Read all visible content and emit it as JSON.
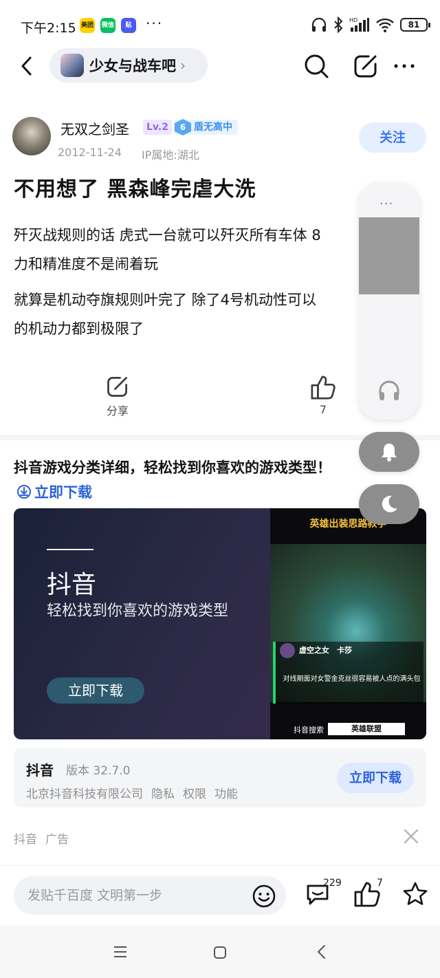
{
  "status_bar": {
    "time": "下午2:15",
    "app_icons": [
      "美团",
      "微信",
      "贴"
    ],
    "more": "···",
    "battery": "81"
  },
  "nav": {
    "forum_name": "少女与战车吧",
    "forum_chevron": "›"
  },
  "post": {
    "author": "无双之剑圣",
    "level": "Lv.2",
    "honor_num": "6",
    "honor_title": "盾无高中",
    "date": "2012-11-24",
    "ip": "IP属地:湖北",
    "follow_label": "关注",
    "title": "不用想了 黑森峰完虐大洗",
    "paragraphs": [
      [
        "歼灭战规则的话 虎式一台就可以歼灭所有车体 8",
        "力和精准度不是闹着玩"
      ],
      [
        "就算是机动夺旗规则叶完了 除了4号机动性可以",
        "的机动力都到极限了"
      ]
    ],
    "share_label": "分享",
    "like_count": "7"
  },
  "ad": {
    "headline": "抖音游戏分类详细，轻松找到你喜欢的游戏类型！",
    "download_link": "立即下载",
    "banner": {
      "brand": "抖音",
      "tagline": "轻松找到你喜欢的游戏类型",
      "button": "立即下载",
      "video_title": "英雄出装思路教学",
      "video_hero": "虚空之女　卡莎",
      "video_caption": "对线期面对女警金克丝很容易被人点的满头包",
      "video_search_label": "抖音搜索",
      "video_search_term": "英雄联盟"
    },
    "app_name": "抖音",
    "version": "版本 32.7.0",
    "meta": [
      "北京抖音科技有限公司",
      "隐私",
      "权限",
      "功能"
    ],
    "button": "立即下载",
    "source": [
      "抖音",
      "广告"
    ]
  },
  "bottom_bar": {
    "reply_placeholder": "发贴千百度 文明第一步",
    "comment_count": "229",
    "like_count": "7"
  },
  "float_panel": {
    "handle": "···"
  }
}
